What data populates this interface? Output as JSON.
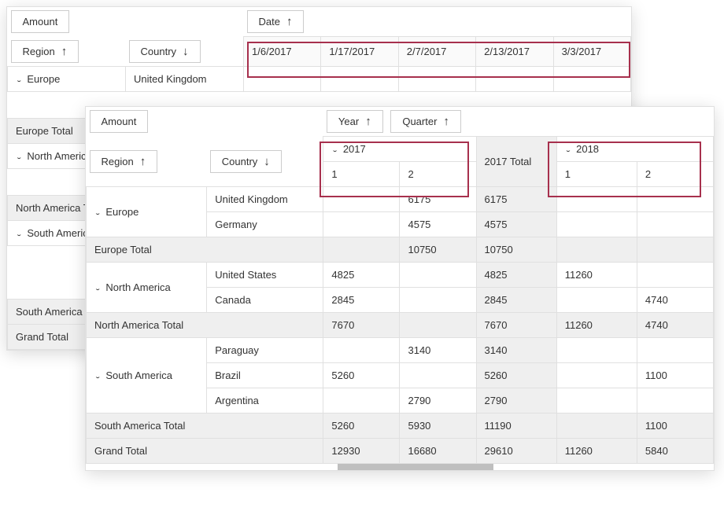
{
  "measure": "Amount",
  "fields": {
    "region": "Region",
    "country": "Country",
    "date": "Date",
    "year": "Year",
    "quarter": "Quarter"
  },
  "back": {
    "dates": [
      "1/6/2017",
      "1/17/2017",
      "2/7/2017",
      "2/13/2017",
      "3/3/2017"
    ],
    "rows": [
      {
        "region": "Europe",
        "country": "United Kingdom"
      }
    ],
    "sections": [
      "Europe Total",
      "North America",
      "North America Total",
      "South America",
      "South America Total",
      "Grand Total"
    ]
  },
  "front": {
    "years": [
      "2017",
      "2018"
    ],
    "year_total_label": "2017 Total",
    "quarters": [
      "1",
      "2"
    ],
    "rows": [
      {
        "region": "Europe",
        "country": "United Kingdom",
        "v": [
          "",
          "6175",
          "6175",
          "",
          ""
        ]
      },
      {
        "region": "",
        "country": "Germany",
        "v": [
          "",
          "4575",
          "4575",
          "",
          ""
        ]
      },
      {
        "total": "Europe Total",
        "v": [
          "",
          "10750",
          "10750",
          "",
          ""
        ]
      },
      {
        "region": "North America",
        "country": "United States",
        "v": [
          "4825",
          "",
          "4825",
          "11260",
          ""
        ]
      },
      {
        "region": "",
        "country": "Canada",
        "v": [
          "2845",
          "",
          "2845",
          "",
          "4740"
        ]
      },
      {
        "total": "North America Total",
        "v": [
          "7670",
          "",
          "7670",
          "11260",
          "4740"
        ]
      },
      {
        "region": "South America",
        "country": "Paraguay",
        "v": [
          "",
          "3140",
          "3140",
          "",
          ""
        ]
      },
      {
        "region": "",
        "country": "Brazil",
        "v": [
          "5260",
          "",
          "5260",
          "",
          "1100"
        ]
      },
      {
        "region": "",
        "country": "Argentina",
        "v": [
          "",
          "2790",
          "2790",
          "",
          ""
        ]
      },
      {
        "total": "South America Total",
        "v": [
          "5260",
          "5930",
          "11190",
          "",
          "1100"
        ]
      },
      {
        "total": "Grand Total",
        "v": [
          "12930",
          "16680",
          "29610",
          "11260",
          "5840"
        ]
      }
    ]
  }
}
